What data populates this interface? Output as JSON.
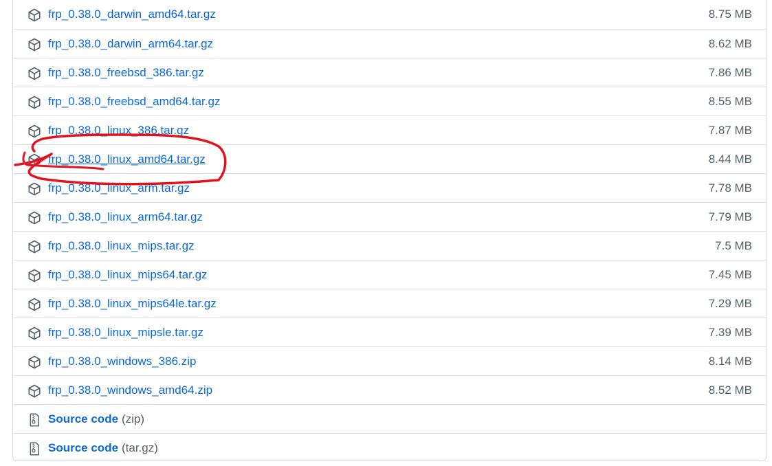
{
  "assets": [
    {
      "name": "frp_0.38.0_darwin_amd64.tar.gz",
      "size": "8.75 MB",
      "icon": "package-icon"
    },
    {
      "name": "frp_0.38.0_darwin_arm64.tar.gz",
      "size": "8.62 MB",
      "icon": "package-icon"
    },
    {
      "name": "frp_0.38.0_freebsd_386.tar.gz",
      "size": "7.86 MB",
      "icon": "package-icon"
    },
    {
      "name": "frp_0.38.0_freebsd_amd64.tar.gz",
      "size": "8.55 MB",
      "icon": "package-icon"
    },
    {
      "name": "frp_0.38.0_linux_386.tar.gz",
      "size": "7.87 MB",
      "icon": "package-icon"
    },
    {
      "name": "frp_0.38.0_linux_amd64.tar.gz",
      "size": "8.44 MB",
      "icon": "package-icon",
      "highlighted": true
    },
    {
      "name": "frp_0.38.0_linux_arm.tar.gz",
      "size": "7.78 MB",
      "icon": "package-icon"
    },
    {
      "name": "frp_0.38.0_linux_arm64.tar.gz",
      "size": "7.79 MB",
      "icon": "package-icon"
    },
    {
      "name": "frp_0.38.0_linux_mips.tar.gz",
      "size": "7.5 MB",
      "icon": "package-icon"
    },
    {
      "name": "frp_0.38.0_linux_mips64.tar.gz",
      "size": "7.45 MB",
      "icon": "package-icon"
    },
    {
      "name": "frp_0.38.0_linux_mips64le.tar.gz",
      "size": "7.29 MB",
      "icon": "package-icon"
    },
    {
      "name": "frp_0.38.0_linux_mipsle.tar.gz",
      "size": "7.39 MB",
      "icon": "package-icon"
    },
    {
      "name": "frp_0.38.0_windows_386.zip",
      "size": "8.14 MB",
      "icon": "package-icon"
    },
    {
      "name": "frp_0.38.0_windows_amd64.zip",
      "size": "8.52 MB",
      "icon": "package-icon"
    }
  ],
  "source_code": [
    {
      "label": "Source code",
      "suffix": "(zip)",
      "icon": "file-zip-icon"
    },
    {
      "label": "Source code",
      "suffix": "(tar.gz)",
      "icon": "file-zip-icon"
    }
  ],
  "colors": {
    "link": "#0969da",
    "muted": "#57606a",
    "border": "#d0d7de",
    "annotation": "#e0141e"
  }
}
